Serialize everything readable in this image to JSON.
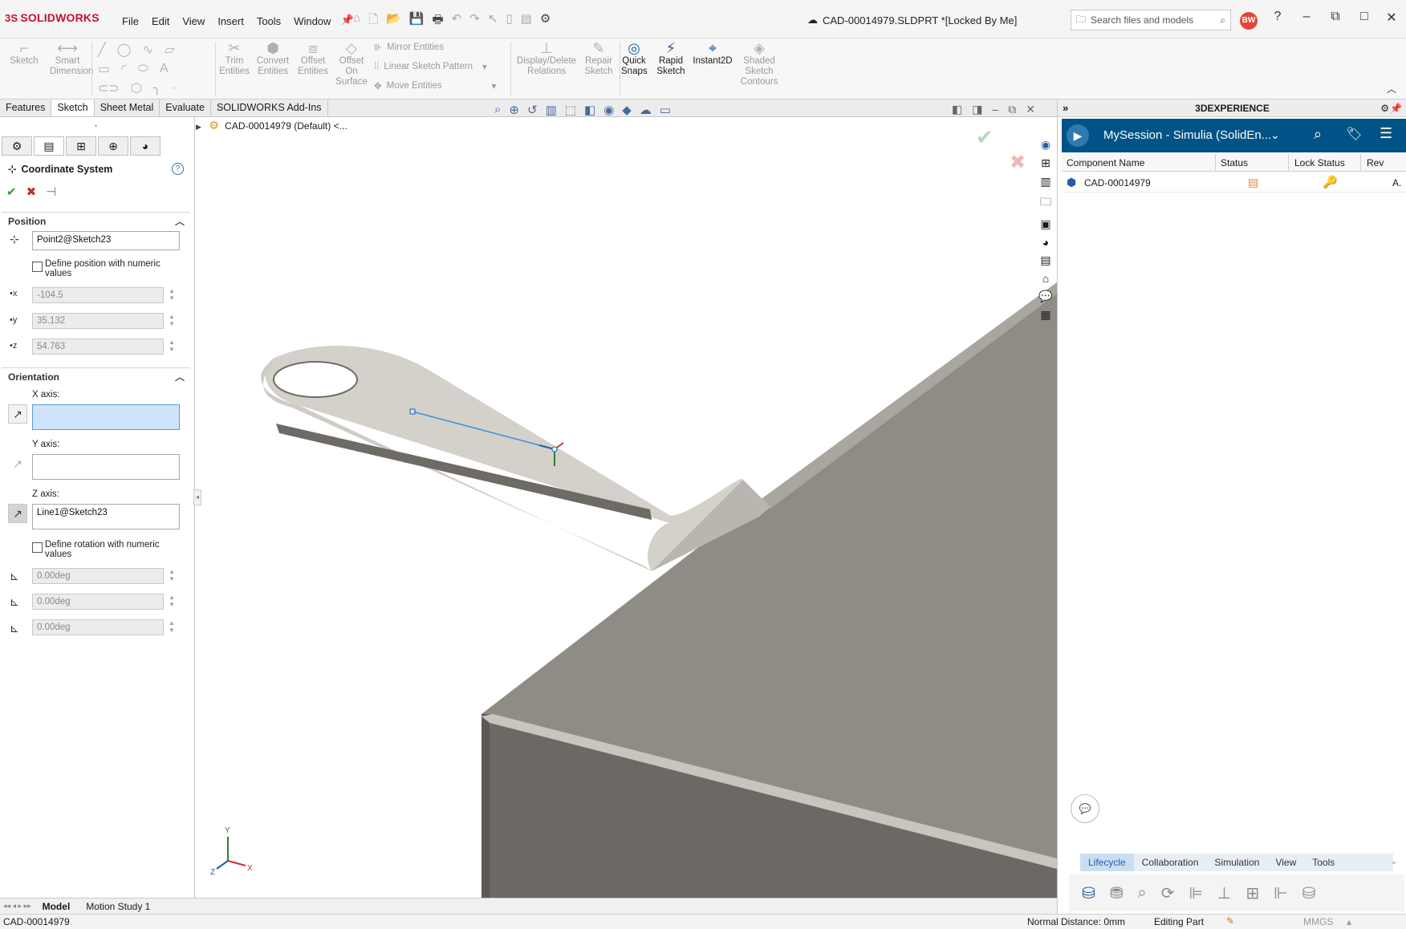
{
  "app": {
    "logo_text": "SOLIDWORKS",
    "logo_mark": "3S",
    "menu": [
      "File",
      "Edit",
      "View",
      "Insert",
      "Tools",
      "Window"
    ],
    "doc_title": "CAD-00014979.SLDPRT *[Locked By Me]",
    "search_placeholder": "Search files and models",
    "avatar_initials": "BW"
  },
  "ribbon": {
    "sketch": "Sketch",
    "smart_dimension": [
      "Smart",
      "Dimension"
    ],
    "trim": [
      "Trim",
      "Entities"
    ],
    "convert": [
      "Convert",
      "Entities"
    ],
    "offset": [
      "Offset",
      "Entities"
    ],
    "offset_surface": [
      "Offset",
      "On",
      "Surface"
    ],
    "mirror": "Mirror Entities",
    "linear_pattern": "Linear Sketch Pattern",
    "move": "Move Entities",
    "display_delete": [
      "Display/Delete",
      "Relations"
    ],
    "repair": [
      "Repair",
      "Sketch"
    ],
    "quick_snaps": [
      "Quick",
      "Snaps"
    ],
    "rapid_sketch": [
      "Rapid",
      "Sketch"
    ],
    "instant2d": "Instant2D",
    "shaded": [
      "Shaded",
      "Sketch",
      "Contours"
    ]
  },
  "command_tabs": [
    "Features",
    "Sketch",
    "Sheet Metal",
    "Evaluate",
    "SOLIDWORKS Add-Ins"
  ],
  "active_command_tab": "Sketch",
  "feature_tree": {
    "root": "CAD-00014979 (Default) <..."
  },
  "property_manager": {
    "title": "Coordinate System",
    "position_label": "Position",
    "position_value": "Point2@Sketch23",
    "define_position": "Define position with numeric values",
    "x": "-104.5",
    "y": "35.132",
    "z": "54.763",
    "orientation_label": "Orientation",
    "x_axis_label": "X axis:",
    "x_axis_value": "",
    "y_axis_label": "Y axis:",
    "y_axis_value": "",
    "z_axis_label": "Z axis:",
    "z_axis_value": "Line1@Sketch23",
    "define_rotation": "Define rotation with numeric values",
    "rx": "0.00deg",
    "ry": "0.00deg",
    "rz": "0.00deg"
  },
  "bottom_tabs": [
    "Model",
    "Motion Study 1"
  ],
  "status": {
    "left": "CAD-00014979",
    "normal_distance": "Normal Distance: 0mm",
    "mode": "Editing Part",
    "units": "MMGS"
  },
  "task_pane": {
    "header": "3DEXPERIENCE",
    "session": "MySession - Simulia (SolidEn...",
    "columns": [
      "Component Name",
      "Status",
      "Lock Status",
      "Rev"
    ],
    "rows": [
      {
        "name": "CAD-00014979",
        "rev": "A."
      }
    ],
    "bottom_tabs": [
      "Lifecycle",
      "Collaboration",
      "Simulation",
      "View",
      "Tools"
    ],
    "active_tab": "Lifecycle"
  },
  "colors": {
    "accent": "#c8102e",
    "session_bar": "#005386",
    "model_face": "#8f8c86",
    "model_side": "#6c6964",
    "sketch_line": "#3a8fd8"
  }
}
